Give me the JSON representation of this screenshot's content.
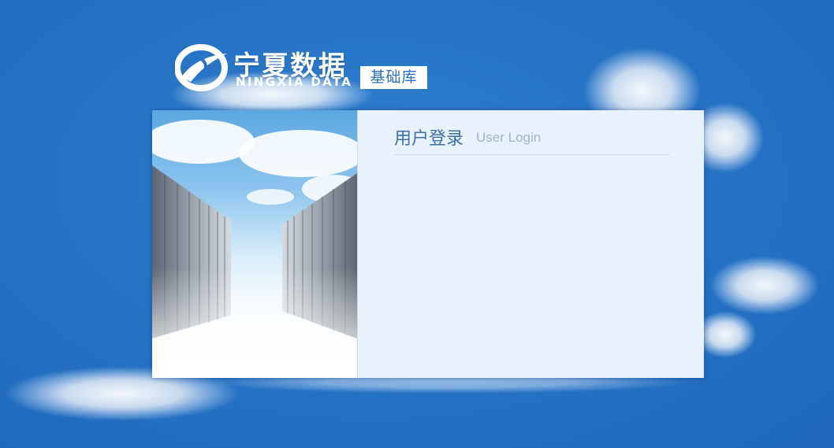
{
  "logo": {
    "name_cn": "宁夏数据",
    "name_en": "NINGXIA DATA",
    "badge": "基础库",
    "icon": "ningxia-data-logo-icon"
  },
  "login": {
    "title_cn": "用户登录",
    "title_en": "User Login"
  },
  "illustration": {
    "icon": "server-corridor-illustration"
  },
  "colors": {
    "background": "#2673c6",
    "panel": "#e7f2fd",
    "title": "#3a6fa8",
    "subtitle": "#9fb3c6",
    "badge_text": "#2a6fbd"
  }
}
